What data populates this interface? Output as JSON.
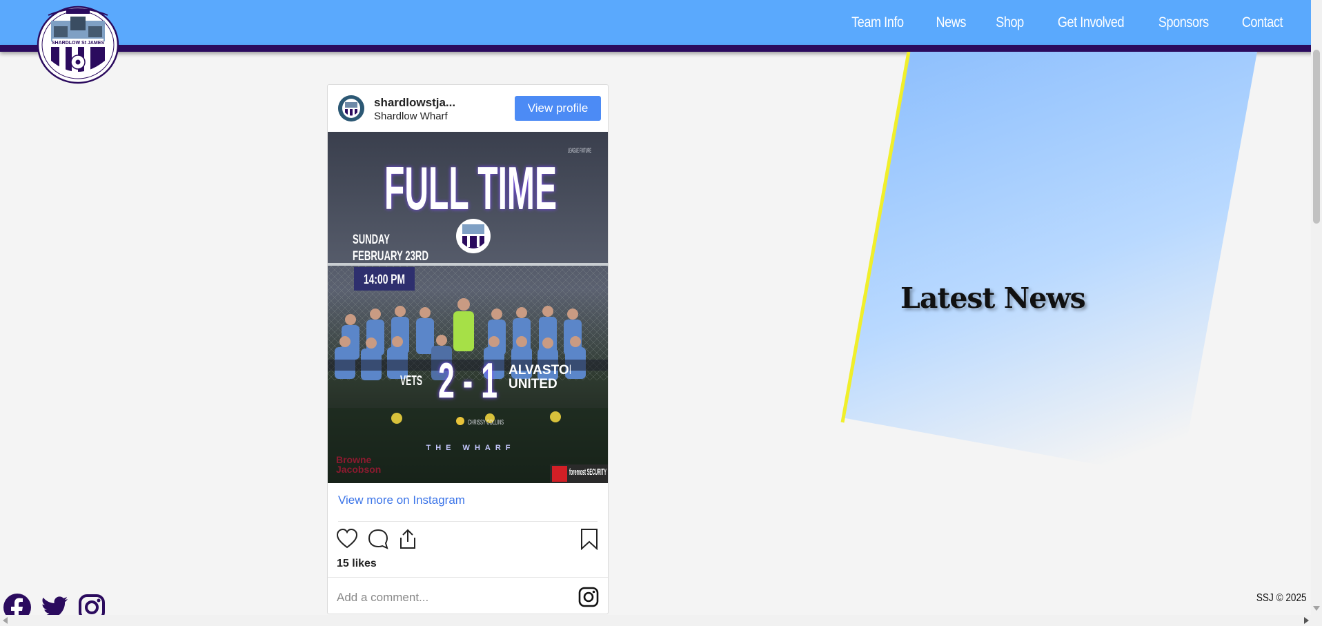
{
  "colors": {
    "header": "#5aa9fd",
    "stripe": "#2b0b5e",
    "accent_yellow": "#f0ef2b",
    "panel_blue": "#9ec9ff",
    "ig_button": "#4c8bf5",
    "ig_link": "#3b74e8",
    "brand_purple": "#2b0b5e"
  },
  "logo": {
    "icon": "club-crest-icon",
    "text": "SHARDLOW St JAMES"
  },
  "nav": {
    "items": [
      {
        "label": "Team Info"
      },
      {
        "label": "News"
      },
      {
        "label": "Shop"
      },
      {
        "label": "Get Involved"
      },
      {
        "label": "Sponsors"
      },
      {
        "label": "Contact"
      }
    ]
  },
  "news": {
    "title": "Latest News"
  },
  "instagram": {
    "username": "shardlowstja...",
    "location": "Shardlow Wharf",
    "view_profile": "View profile",
    "view_more": "View more on Instagram",
    "likes": "15 likes",
    "comment_placeholder": "Add a comment...",
    "post": {
      "headline": "FULL TIME",
      "tag": "LEAGUE FIXTURE",
      "date_day": "SUNDAY",
      "date": "FEBRUARY 23RD",
      "time": "14:00 PM",
      "home": "VETS",
      "score": "2 - 1",
      "away": "ALVASTON UNITED",
      "potm": "CHRISSY COLLINS",
      "venue": "THE WHARF",
      "sponsor_left": "Browne Jacobson",
      "sponsor_right": "foremost SECURITY"
    }
  },
  "footer": {
    "social": [
      "facebook-icon",
      "twitter-icon",
      "instagram-icon"
    ],
    "copyright": "SSJ © 2025"
  }
}
